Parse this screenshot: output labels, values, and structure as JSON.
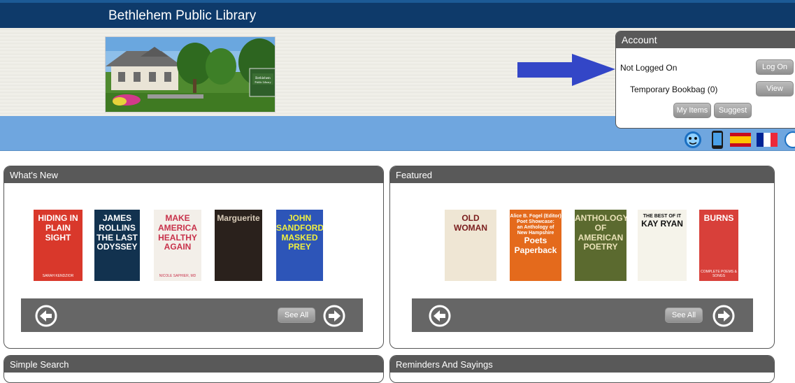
{
  "header": {
    "title": "Bethlehem Public Library"
  },
  "account": {
    "heading": "Account",
    "status": "Not Logged On",
    "bookbag": "Temporary Bookbag (0)",
    "log_on": "Log On",
    "view": "View",
    "my_items": "My Items",
    "suggest": "Suggest"
  },
  "panels": {
    "whats_new": {
      "title": "What's New",
      "see_all": "See All"
    },
    "featured": {
      "title": "Featured",
      "see_all": "See All"
    },
    "simple_search": {
      "title": "Simple Search"
    },
    "reminders": {
      "title": "Reminders And Sayings"
    }
  },
  "whats_new_books": [
    {
      "lines": [
        "HIDING IN",
        "PLAIN SIGHT"
      ],
      "sub": "SARAH KENDZIOR",
      "bg": "#d9382b",
      "fg": "#ffffff"
    },
    {
      "lines": [
        "JAMES",
        "ROLLINS",
        "THE LAST",
        "ODYSSEY"
      ],
      "sub": "",
      "bg": "#12324f",
      "fg": "#ffffff"
    },
    {
      "lines": [
        "MAKE",
        "AMERICA",
        "HEALTHY",
        "AGAIN"
      ],
      "sub": "NICOLE SAPHIER, MD",
      "bg": "#f3efe9",
      "fg": "#c8324b"
    },
    {
      "lines": [
        "Marguerite"
      ],
      "sub": "",
      "bg": "#2a211c",
      "fg": "#d8cbb8"
    },
    {
      "lines": [
        "JOHN",
        "SANDFORD",
        "MASKED",
        "PREY"
      ],
      "sub": "",
      "bg": "#2d55b8",
      "fg": "#f0f040"
    }
  ],
  "featured_books": [
    {
      "lines": [
        "OLD WOMAN"
      ],
      "sub": "",
      "bg": "#efe6d4",
      "fg": "#7a1d1d"
    },
    {
      "lines": [
        "Alice B. Fogel (Editor)",
        "Poet Showcase:",
        "an Anthology of",
        "New Hampshire",
        "Poets",
        "Paperback"
      ],
      "sub": "",
      "bg": "#e46a1c",
      "fg": "#ffffff"
    },
    {
      "lines": [
        "ANTHOLOGY",
        "OF",
        "AMERICAN",
        "POETRY"
      ],
      "sub": "",
      "bg": "#5b6a2f",
      "fg": "#eae2b8"
    },
    {
      "lines": [
        "THE BEST OF IT",
        "KAY RYAN"
      ],
      "sub": "",
      "bg": "#f5f3ea",
      "fg": "#111111"
    },
    {
      "lines": [
        "BURNS"
      ],
      "sub": "COMPLETE POEMS & SONGS",
      "bg": "#d8403a",
      "fg": "#ffffff"
    }
  ],
  "colors": {
    "topbar": "#0e3a6a",
    "bluebar": "#6fa6df",
    "panel_head": "#595959",
    "carousel_bar": "#666666",
    "arrow": "#3346c7"
  },
  "icons": [
    "accessibility-icon",
    "mobile-phone-icon",
    "spanish-flag-icon",
    "french-flag-icon",
    "help-icon"
  ]
}
